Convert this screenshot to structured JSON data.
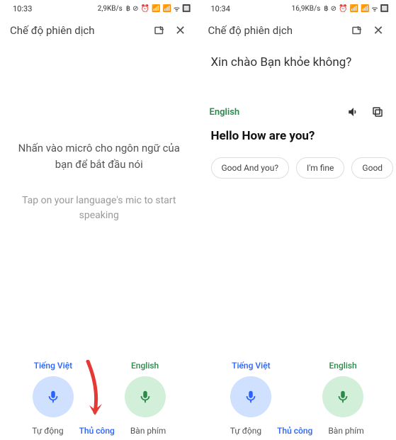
{
  "left": {
    "status": {
      "time": "10:33",
      "speed": "2,9KB/s"
    },
    "header": {
      "title": "Chế độ phiên dịch"
    },
    "prompt_vi": "Nhấn vào micrô cho ngôn ngữ của bạn để bắt đầu nói",
    "prompt_en": "Tap on your language's mic to start speaking",
    "mic": {
      "lang1": "Tiếng Việt",
      "lang2": "English"
    },
    "tabs": {
      "auto": "Tự động",
      "manual": "Thủ công",
      "keyboard": "Bàn phím"
    }
  },
  "right": {
    "status": {
      "time": "10:34",
      "speed": "16,9KB/s"
    },
    "header": {
      "title": "Chế độ phiên dịch"
    },
    "source_text": "Xin chào Bạn khỏe không?",
    "target_lang": "English",
    "target_text": "Hello How are you?",
    "chips": [
      "Good And you?",
      "I'm fine",
      "Good"
    ],
    "mic": {
      "lang1": "Tiếng Việt",
      "lang2": "English"
    },
    "tabs": {
      "auto": "Tự động",
      "manual": "Thủ công",
      "keyboard": "Bàn phím"
    }
  }
}
